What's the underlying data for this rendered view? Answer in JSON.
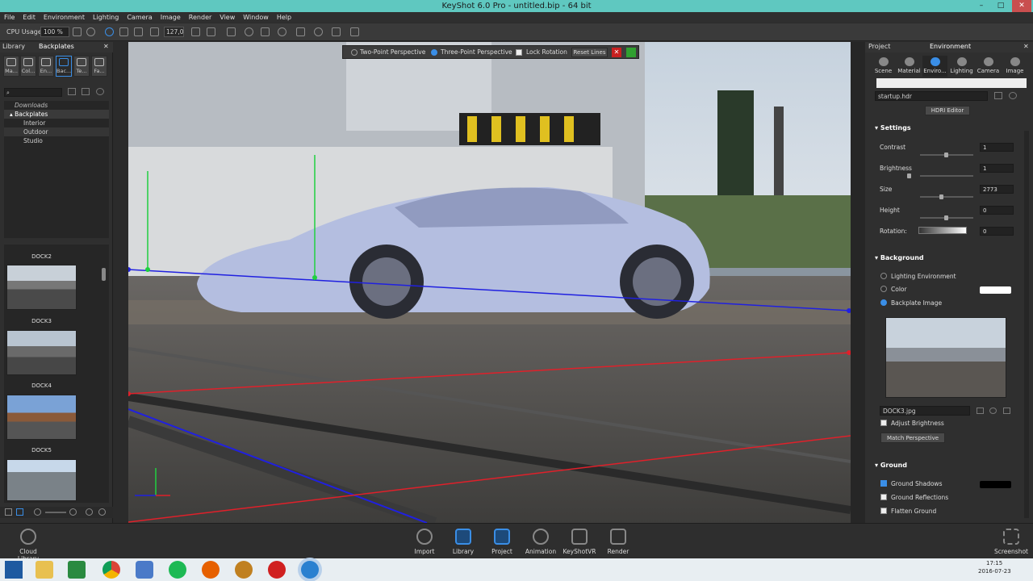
{
  "window": {
    "title": "KeyShot 6.0 Pro  -  untitled.bip  -  64 bit",
    "min": "–",
    "max": "□",
    "close": "✕"
  },
  "menu": [
    "File",
    "Edit",
    "Environment",
    "Lighting",
    "Camera",
    "Image",
    "Render",
    "View",
    "Window",
    "Help"
  ],
  "toolbar": {
    "cpu_label": "CPU Usage",
    "cpu_value": "100 %",
    "fov_value": "127,0"
  },
  "library": {
    "title": "Library",
    "active_tab": "Backplates",
    "tabs": [
      "Ma...",
      "Col...",
      "En...",
      "Bac...",
      "Te...",
      "Fa..."
    ],
    "tree": {
      "root": "Downloads",
      "folder": "Backplates",
      "children": [
        "Interior",
        "Outdoor",
        "Studio"
      ]
    },
    "thumbs": [
      "DOCK2",
      "DOCK3",
      "DOCK4",
      "DOCK5"
    ]
  },
  "perspective_bar": {
    "two_point": "Two-Point Perspective",
    "three_point": "Three-Point Perspective",
    "lock_rotation": "Lock Rotation",
    "reset_lines": "Reset Lines"
  },
  "project": {
    "title": "Project",
    "section": "Environment",
    "tabs": [
      "Scene",
      "Material",
      "Enviro...",
      "Lighting",
      "Camera",
      "Image"
    ],
    "hdri_file": "startup.hdr",
    "hdri_editor": "HDRI Editor",
    "settings": {
      "header": "Settings",
      "contrast_label": "Contrast",
      "contrast_value": "1",
      "brightness_label": "Brightness",
      "brightness_value": "1",
      "size_label": "Size",
      "size_value": "2773",
      "height_label": "Height",
      "height_value": "0",
      "rotation_label": "Rotation:",
      "rotation_value": "0"
    },
    "background": {
      "header": "Background",
      "lighting_env": "Lighting Environment",
      "color": "Color",
      "backplate": "Backplate Image",
      "file": "DOCK3.jpg",
      "adjust": "Adjust Brightness",
      "match": "Match Perspective"
    },
    "ground": {
      "header": "Ground",
      "shadows": "Ground Shadows",
      "reflections": "Ground Reflections",
      "flatten": "Flatten Ground"
    }
  },
  "bottombar": {
    "cloud": "Cloud Library",
    "items": [
      "Import",
      "Library",
      "Project",
      "Animation",
      "KeyShotVR",
      "Render"
    ],
    "screenshot": "Screenshot"
  },
  "taskbar": {
    "time": "17:15",
    "date": "2016-07-23"
  },
  "colors": {
    "accent": "#3a8ee6",
    "titlebar": "#5fc8c0",
    "red_line": "#e0202a",
    "blue_line": "#2020e0",
    "green_line": "#20d040"
  }
}
